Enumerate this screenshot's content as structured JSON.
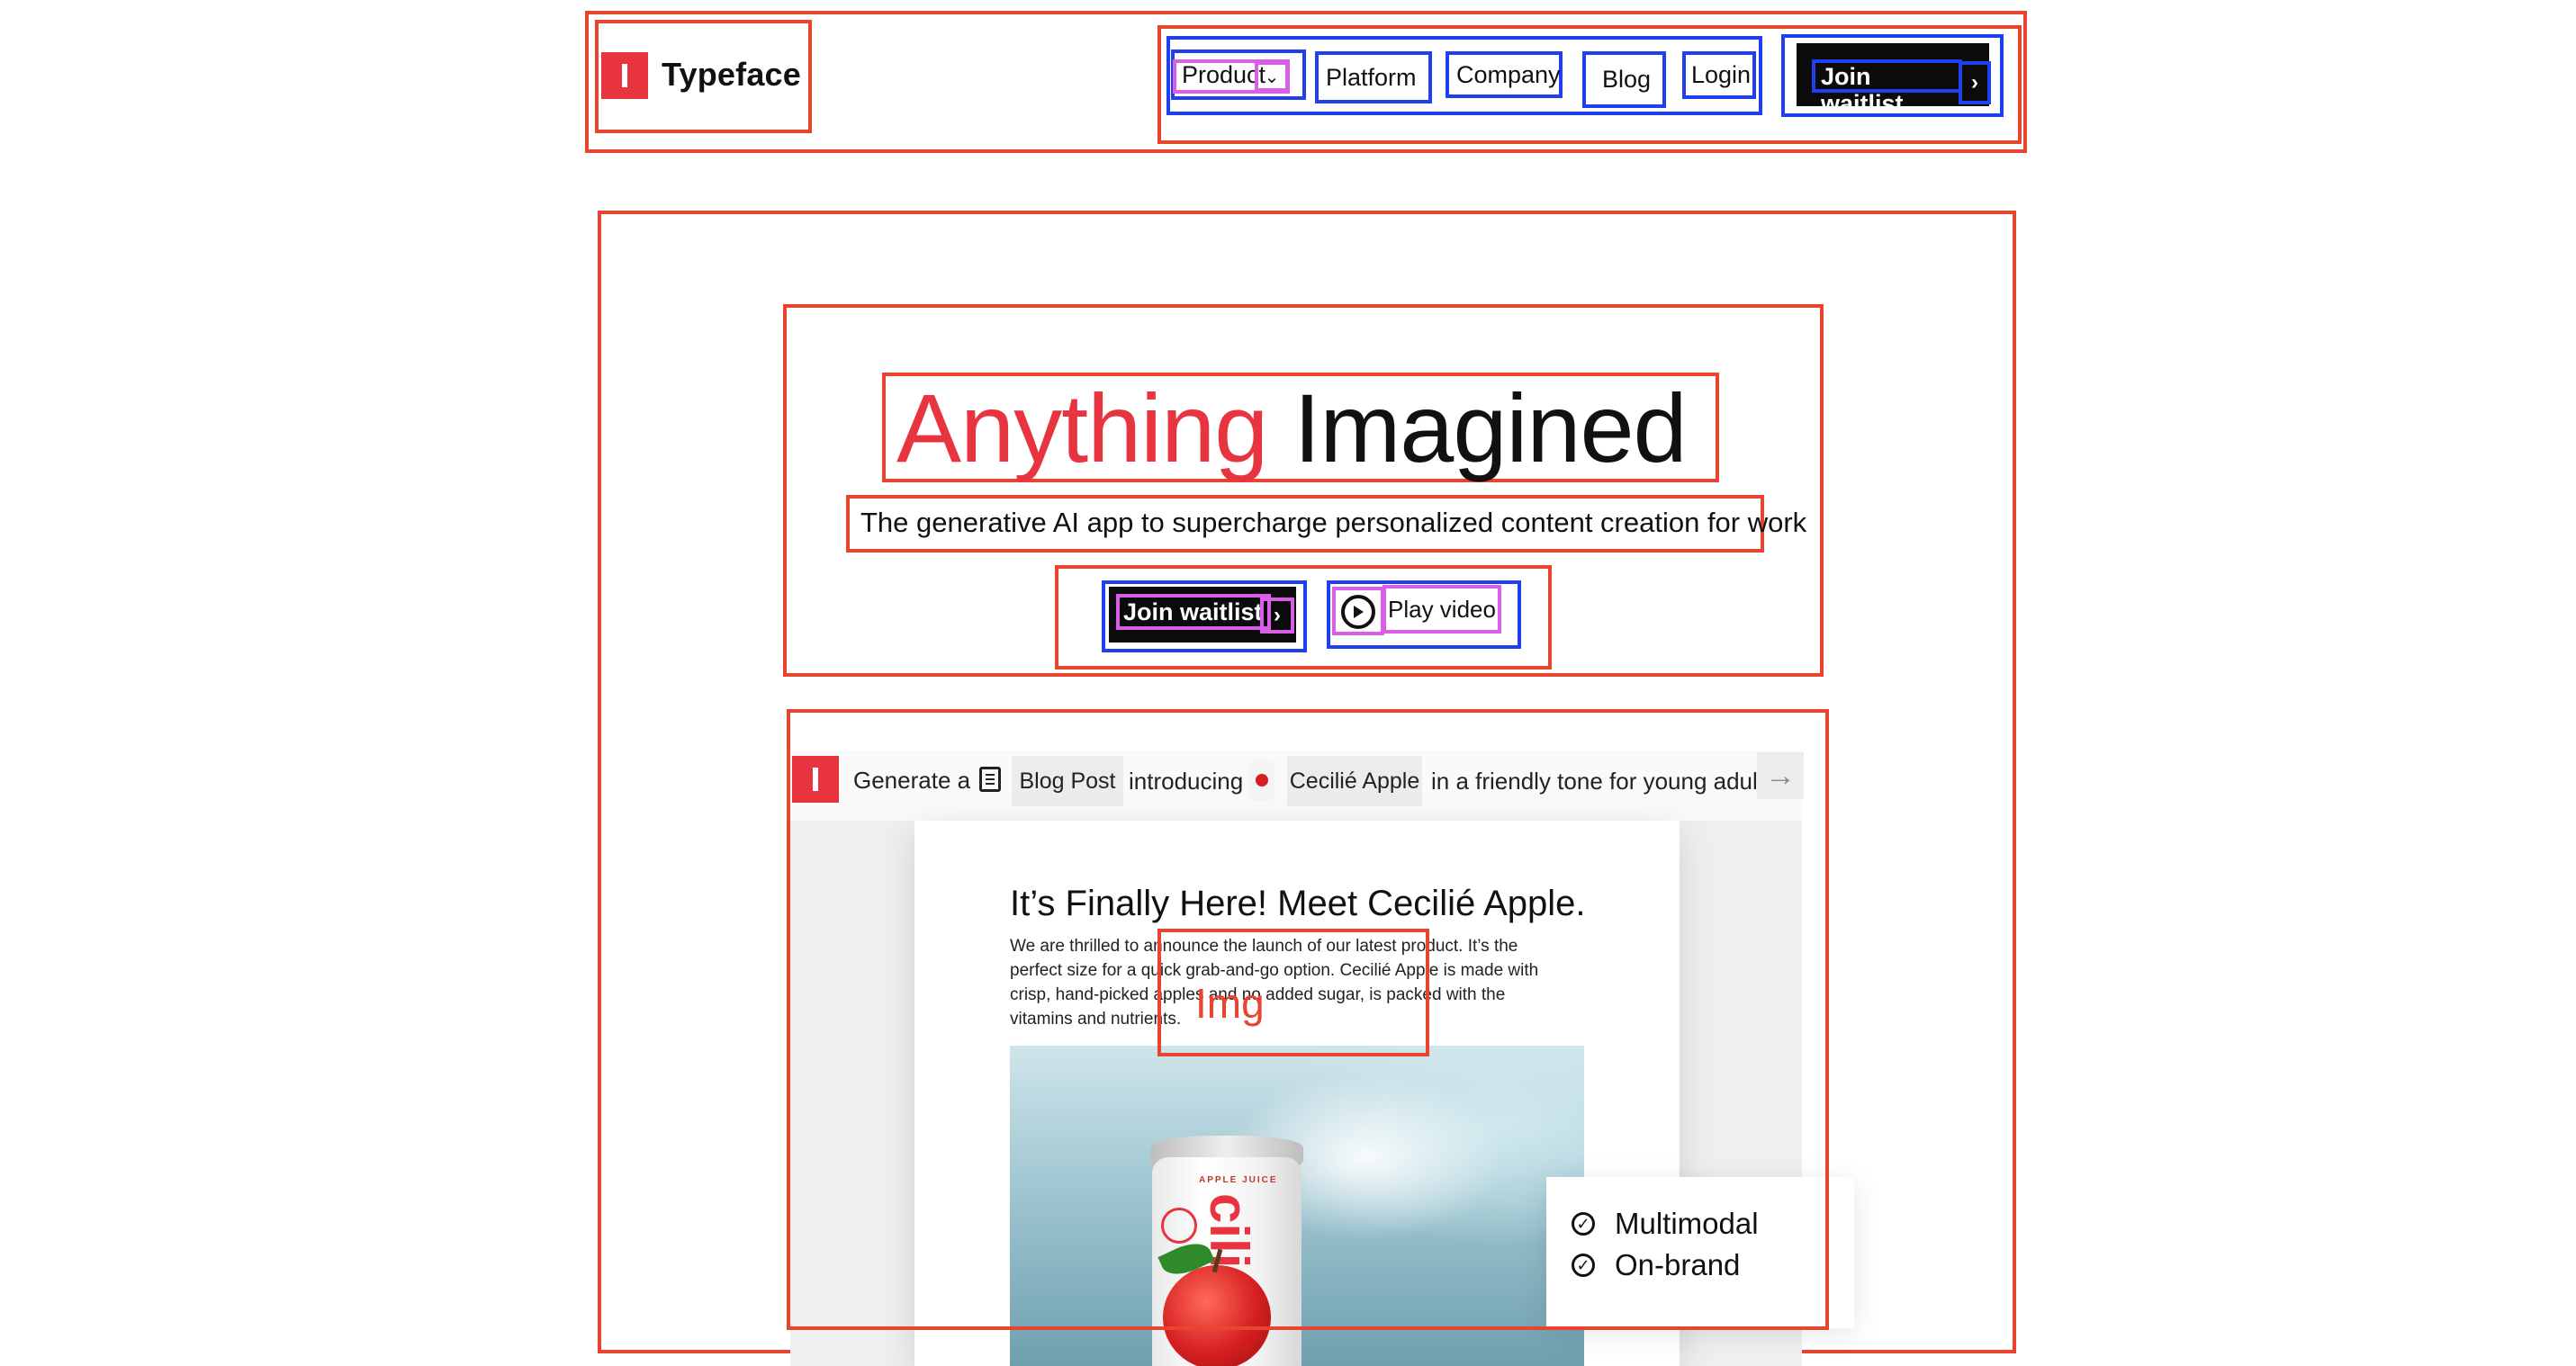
{
  "header": {
    "brand": "Typeface",
    "nav": [
      "Product",
      "Platform",
      "Company",
      "Blog",
      "Login"
    ],
    "cta": "Join waitlist"
  },
  "hero": {
    "headline_accent": "Anything",
    "headline_rest": "Imagined",
    "subtitle": "The generative AI app to supercharge personalized content creation for work",
    "primary_cta": "Join waitlist",
    "secondary_cta": "Play video"
  },
  "prompt": {
    "generate": "Generate a",
    "type_chip": "Blog Post",
    "introducing": "introducing",
    "product_chip": "Cecilié Apple",
    "tail": "in a friendly tone for young adults"
  },
  "preview": {
    "title": "It’s Finally Here! Meet Cecilié Apple.",
    "body": "We are thrilled to announce the launch of our latest product. It’s the perfect size for a quick grab-and-go option. Cecilié Apple is made with crisp, hand-picked apples and no added sugar, is packed with the vitamins and nutrients.",
    "can_small": "APPLE JUICE",
    "can_brand": "cilie",
    "img_marker": "Img",
    "features": [
      "Multimodal",
      "On-brand"
    ]
  },
  "colors": {
    "accent": "#e8343e",
    "annotation_red": "#e8442f",
    "annotation_blue": "#1f3ff0",
    "annotation_pink": "#d95ee8"
  }
}
